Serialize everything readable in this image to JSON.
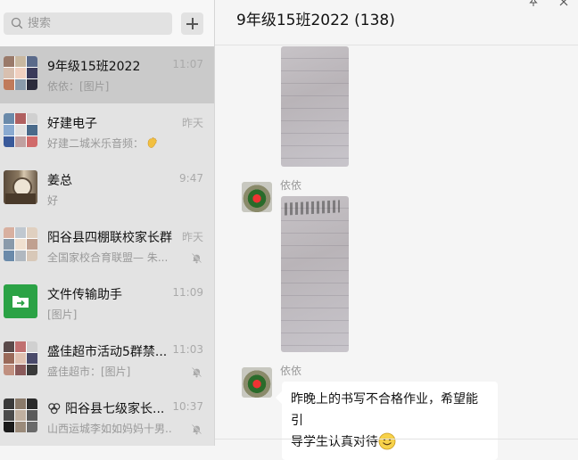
{
  "search": {
    "placeholder": "搜索"
  },
  "chats": [
    {
      "name": "9年级15班2022",
      "preview": "依依：[图片]",
      "time": "11:07",
      "active": true,
      "muted": false,
      "avatar_colors": [
        "#9a7a6a",
        "#c9b8a0",
        "#5a6a8a",
        "#d8c0b0",
        "#f0d0c0",
        "#3a3a5a",
        "#c07a5a",
        "#8a9aaa",
        "#2a2a3a"
      ]
    },
    {
      "name": "好建电子",
      "preview": "好建二城米乐音频：",
      "time": "昨天",
      "muted": false,
      "emoji": "wave",
      "avatar_colors": [
        "#6a8aaa",
        "#b06060",
        "#d0d0d0",
        "#8aaad0",
        "#e0e0e0",
        "#4a6a8a",
        "#3a5a9a",
        "#c0a0a0",
        "#d06a6a"
      ]
    },
    {
      "name": "姜总",
      "preview": "好",
      "time": "9:47",
      "muted": false,
      "avatar_colors": [
        "#6a5a4a",
        "#8a7a6a",
        "#9a8a7a",
        "#4a3a2a",
        "#ecdcc8",
        "#5a4a3a",
        "#3a2a1a",
        "#7a6a5a",
        "#2a2a2a"
      ]
    },
    {
      "name": "阳谷县四棚联校家长群",
      "preview": "全国家校合育联盟—  朱...",
      "time": "昨天",
      "muted": true,
      "avatar_colors": [
        "#d8b0a0",
        "#c0c8d0",
        "#e0d0c0",
        "#8a9aaa",
        "#f0e0d0",
        "#c0a090",
        "#6a8aaa",
        "#b0b8c0",
        "#d8c8b8"
      ]
    },
    {
      "name": "文件传输助手",
      "preview": "[图片]",
      "time": "11:09",
      "muted": false,
      "avatar_colors": []
    },
    {
      "name": "盛佳超市活动5群禁...",
      "preview": "盛佳超市：[图片]",
      "time": "11:03",
      "muted": true,
      "avatar_colors": [
        "#5a4a4a",
        "#c07070",
        "#d0d0d0",
        "#9a6a5a",
        "#e0c0b0",
        "#4a4a6a",
        "#c09080",
        "#8a5a5a",
        "#3a3a3a"
      ]
    },
    {
      "name": "阳谷县七级家长...",
      "preview": "山西运城李如如妈妈十男...",
      "time": "10:37",
      "muted": true,
      "avatar_colors": [
        "#3a3a3a",
        "#8a7a6a",
        "#2a2a2a",
        "#4a4a4a",
        "#c0b0a0",
        "#5a5a5a",
        "#1a1a1a",
        "#9a8a7a",
        "#6a6a6a"
      ]
    }
  ],
  "conversation": {
    "title": "9年级15班2022 (138)",
    "messages": [
      {
        "sender": "依依",
        "type": "image"
      },
      {
        "sender": "依依",
        "type": "text",
        "text_line1": "昨晚上的书写不合格作业，希望能引",
        "text_line2": "导学生认真对待"
      }
    ]
  }
}
